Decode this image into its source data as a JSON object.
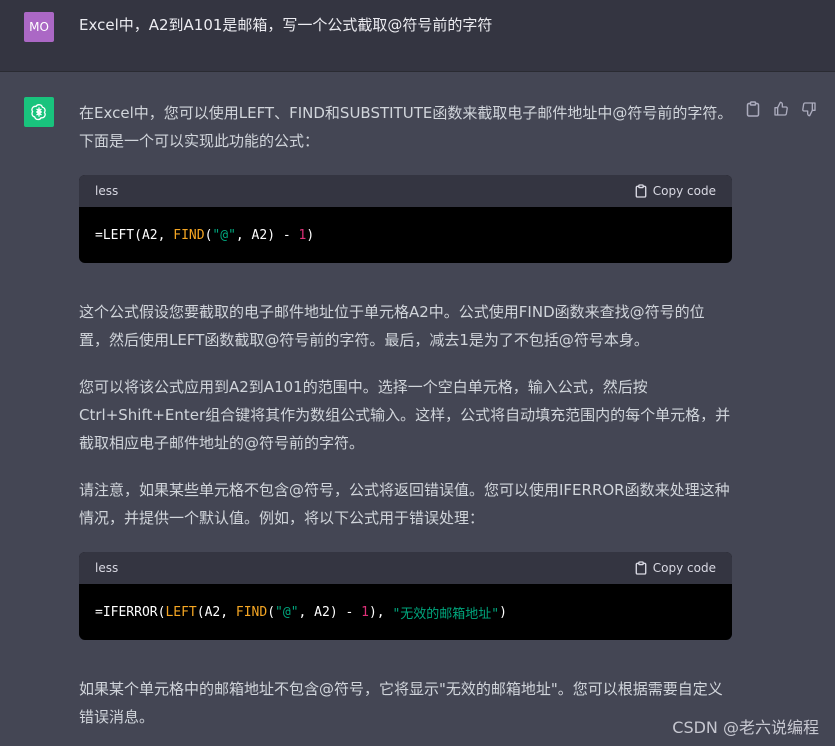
{
  "user": {
    "avatar_initials": "MO",
    "message": "Excel中，A2到A101是邮箱，写一个公式截取@符号前的字符"
  },
  "assistant": {
    "avatar_icon": "openai-logo-icon",
    "actions": [
      "clipboard-icon",
      "thumbs-up-icon",
      "thumbs-down-icon"
    ],
    "para1": "在Excel中，您可以使用LEFT、FIND和SUBSTITUTE函数来截取电子邮件地址中@符号前的字符。下面是一个可以实现此功能的公式：",
    "code1": {
      "language": "less",
      "copy_label": "Copy code",
      "tokens": [
        {
          "t": "=LEFT(A2, ",
          "c": "plain"
        },
        {
          "t": "FIND",
          "c": "fn"
        },
        {
          "t": "(",
          "c": "plain"
        },
        {
          "t": "\"@\"",
          "c": "str"
        },
        {
          "t": ", A2) - ",
          "c": "plain"
        },
        {
          "t": "1",
          "c": "num"
        },
        {
          "t": ")",
          "c": "plain"
        }
      ]
    },
    "para2": "这个公式假设您要截取的电子邮件地址位于单元格A2中。公式使用FIND函数来查找@符号的位置，然后使用LEFT函数截取@符号前的字符。最后，减去1是为了不包括@符号本身。",
    "para3": "您可以将该公式应用到A2到A101的范围中。选择一个空白单元格，输入公式，然后按Ctrl+Shift+Enter组合键将其作为数组公式输入。这样，公式将自动填充范围内的每个单元格，并截取相应电子邮件地址的@符号前的字符。",
    "para4": "请注意，如果某些单元格不包含@符号，公式将返回错误值。您可以使用IFERROR函数来处理这种情况，并提供一个默认值。例如，将以下公式用于错误处理：",
    "code2": {
      "language": "less",
      "copy_label": "Copy code",
      "tokens": [
        {
          "t": "=IFERROR(",
          "c": "plain"
        },
        {
          "t": "LEFT",
          "c": "fn"
        },
        {
          "t": "(A2, ",
          "c": "plain"
        },
        {
          "t": "FIND",
          "c": "fn"
        },
        {
          "t": "(",
          "c": "plain"
        },
        {
          "t": "\"@\"",
          "c": "str"
        },
        {
          "t": ", A2) - ",
          "c": "plain"
        },
        {
          "t": "1",
          "c": "num"
        },
        {
          "t": "), ",
          "c": "plain"
        },
        {
          "t": "\"无效的邮箱地址\"",
          "c": "str"
        },
        {
          "t": ")",
          "c": "plain"
        }
      ]
    },
    "para5": "如果某个单元格中的邮箱地址不包含@符号，它将显示\"无效的邮箱地址\"。您可以根据需要自定义错误消息。"
  },
  "watermark": "CSDN @老六说编程",
  "colors": {
    "user_bg": "#343541",
    "assistant_bg": "#444654",
    "avatar_user": "#ab68c5",
    "avatar_gpt": "#19c37d",
    "code_fn": "#f5a623",
    "code_str": "#00a67d",
    "code_num": "#df3079"
  }
}
